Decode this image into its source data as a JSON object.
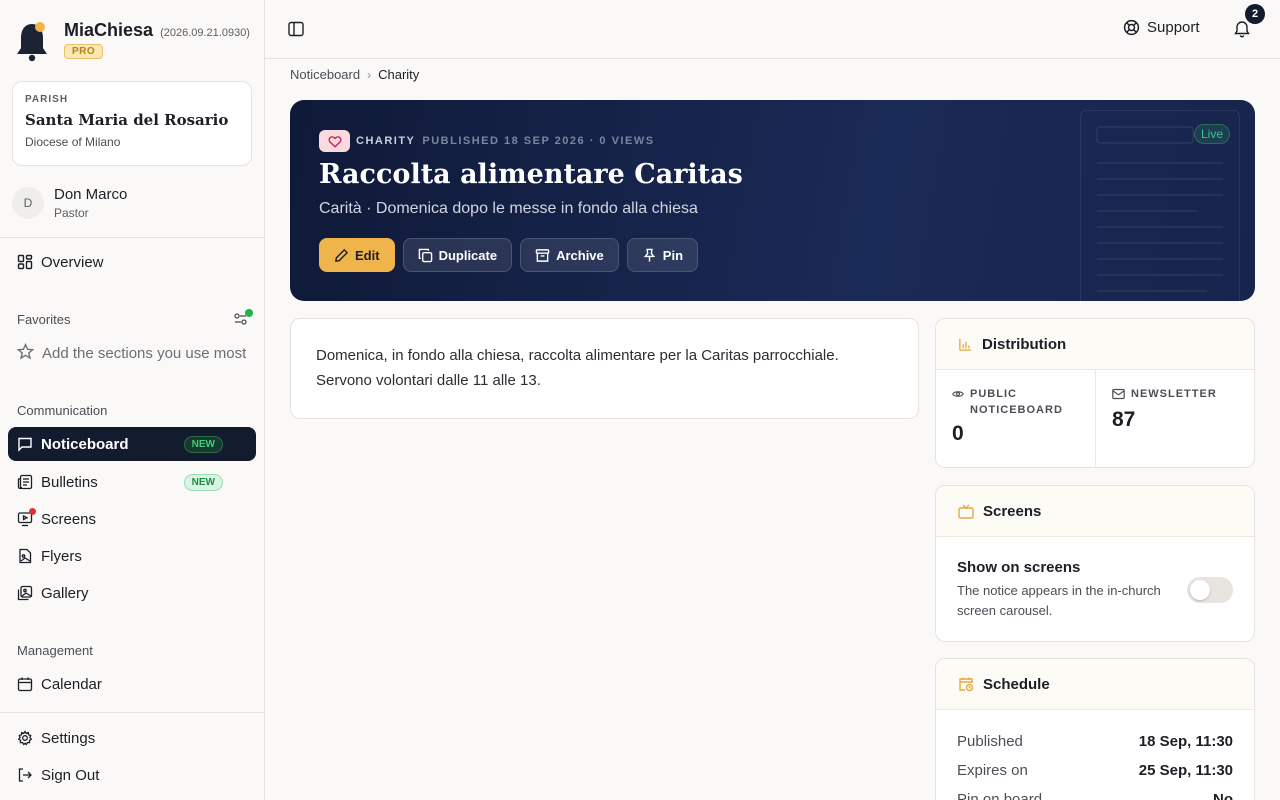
{
  "brand": {
    "name": "MiaChiesa",
    "version": "(2026.09.21.0930)",
    "plan": "PRO"
  },
  "parish": {
    "label": "PARISH",
    "name": "Santa Maria del Rosario",
    "diocese": "Diocese of Milano"
  },
  "user": {
    "initial": "D",
    "name": "Don Marco",
    "role": "Pastor"
  },
  "nav": {
    "overview": "Overview",
    "favorites_label": "Favorites",
    "favorites_hint": "Add the sections you use most",
    "communication_label": "Communication",
    "communication": [
      {
        "label": "Noticeboard",
        "badge": "NEW"
      },
      {
        "label": "Bulletins",
        "badge": "NEW"
      },
      {
        "label": "Screens"
      },
      {
        "label": "Flyers"
      },
      {
        "label": "Gallery"
      }
    ],
    "management_label": "Management",
    "calendar": "Calendar",
    "settings": "Settings",
    "sign_out": "Sign Out"
  },
  "topbar": {
    "support": "Support",
    "notifications_count": "2"
  },
  "breadcrumb": {
    "parent": "Noticeboard",
    "current": "Charity"
  },
  "notice": {
    "category": "CHARITY",
    "meta": "PUBLISHED 18 SEP 2026 · 0 VIEWS",
    "title": "Raccolta alimentare Caritas",
    "subtitle": "Carità · Domenica dopo le messe in fondo alla chiesa",
    "status": "Live",
    "actions": {
      "edit": "Edit",
      "duplicate": "Duplicate",
      "archive": "Archive",
      "pin": "Pin"
    },
    "body": "Domenica, in fondo alla chiesa, raccolta alimentare per la Caritas parrocchiale. Servono volontari dalle 11 alle 13."
  },
  "distribution": {
    "title": "Distribution",
    "public_label": "PUBLIC NOTICEBOARD",
    "public_value": "0",
    "newsletter_label": "NEWSLETTER",
    "newsletter_value": "87"
  },
  "screens": {
    "title": "Screens",
    "show_title": "Show on screens",
    "show_desc": "The notice appears in the in-church screen carousel.",
    "enabled": false
  },
  "schedule": {
    "title": "Schedule",
    "rows": [
      {
        "key": "Published",
        "value": "18 Sep, 11:30"
      },
      {
        "key": "Expires on",
        "value": "25 Sep, 11:30"
      },
      {
        "key": "Pin on board",
        "value": "No"
      }
    ]
  },
  "colors": {
    "accent": "#f0b54a",
    "navy": "#131b2e",
    "hero_from": "#0f1938",
    "hero_to": "#1a2a56",
    "live": "#3fc28a"
  }
}
